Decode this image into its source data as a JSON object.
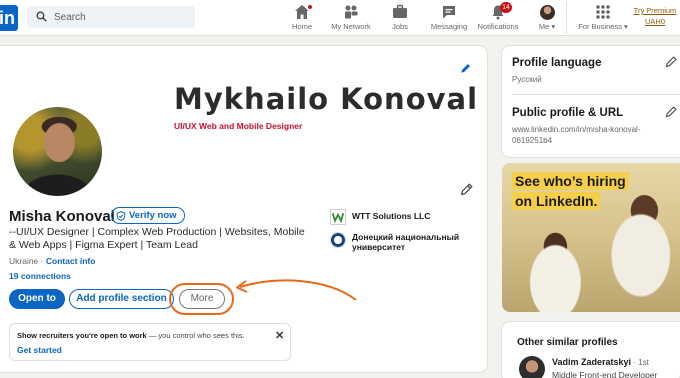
{
  "nav": {
    "logo": "in",
    "search_placeholder": "Search",
    "items": [
      {
        "label": "Home",
        "icon": "home-icon",
        "badge": ""
      },
      {
        "label": "My Network",
        "icon": "network-icon",
        "badge": ""
      },
      {
        "label": "Jobs",
        "icon": "jobs-icon",
        "badge": ""
      },
      {
        "label": "Messaging",
        "icon": "messaging-icon",
        "badge": ""
      },
      {
        "label": "Notifications",
        "icon": "bell-icon",
        "badge": "14"
      },
      {
        "label": "Me ▾",
        "icon": "avatar",
        "badge": ""
      },
      {
        "label": "For Business ▾",
        "icon": "grid-icon",
        "badge": ""
      }
    ],
    "premium_line1": "Try Premium",
    "premium_line2": "UAH0"
  },
  "banner": {
    "name": "Mykhailo Konoval",
    "subtitle": "UI/UX Web and Mobile Designer"
  },
  "profile": {
    "name": "Misha Konoval",
    "verify_label": "Verify now",
    "headline": "--UI/UX Designer | Complex Web Production | Websites, Mobile & Web Apps | Figma Expert | Team Lead",
    "location": "Ukraine",
    "location_sep": " · ",
    "contact_info": "Contact info",
    "connections": "19 connections",
    "open_to_label": "Open to",
    "add_section_label": "Add profile section",
    "more_label": "More",
    "company": "WTT Solutions LLC",
    "university": "Донецкий национальный университет"
  },
  "recruiter_banner": {
    "bold_text": "Show recruiters you're open to work",
    "rest_text": " — you control who sees this.",
    "link": "Get started",
    "close": "✕"
  },
  "sidebar": {
    "language_title": "Profile language",
    "language_value": "Русский",
    "public_title": "Public profile & URL",
    "public_url": "www.linkedin.com/in/misha-konoval-0619251b4",
    "ad_line1": "See who’s hiring",
    "ad_line2": "on LinkedIn.",
    "similar_title": "Other similar profiles",
    "similar_name": "Vadim Zaderatskyi",
    "similar_degree": " · 1st",
    "similar_role": "Middle Front-end Developer"
  },
  "colors": {
    "brand": "#0a66c2",
    "annotation": "#e86a18",
    "badge": "#cc1016",
    "banner_subtitle": "#c8102e",
    "premium": "#915907"
  }
}
